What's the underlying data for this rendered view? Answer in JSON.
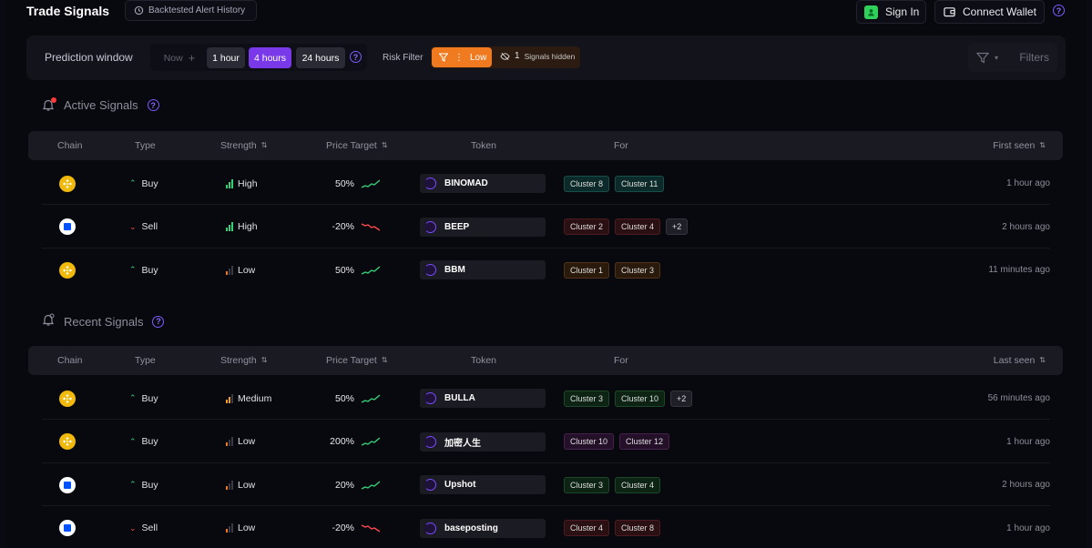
{
  "header": {
    "title": "Trade Signals",
    "history_label": "Backtested Alert History",
    "signin_label": "Sign In",
    "wallet_label": "Connect Wallet"
  },
  "filters": {
    "prediction_label": "Prediction window",
    "windows": [
      "Now",
      "1 hour",
      "4 hours",
      "24 hours"
    ],
    "selected_window": "4 hours",
    "risk_label": "Risk Filter",
    "risk_value": "Low",
    "hidden_count": "1",
    "hidden_label": "Signals hidden",
    "filters_label": "Filters"
  },
  "active": {
    "title": "Active Signals",
    "columns": [
      "Chain",
      "Type",
      "Strength",
      "Price Target",
      "Token",
      "For",
      "First seen"
    ],
    "rows": [
      {
        "chain": "bnb",
        "type": "Buy",
        "strength": "High",
        "target": "50%",
        "token": "BINOMAD",
        "for": [
          [
            "Cluster 8",
            "teal"
          ],
          [
            "Cluster 11",
            "teal"
          ]
        ],
        "seen": "1 hour ago"
      },
      {
        "chain": "base",
        "type": "Sell",
        "strength": "High",
        "target": "-20%",
        "token": "BEEP",
        "for": [
          [
            "Cluster 2",
            "red"
          ],
          [
            "Cluster 4",
            "red"
          ],
          [
            "+2",
            "more"
          ]
        ],
        "seen": "2 hours ago"
      },
      {
        "chain": "bnb",
        "type": "Buy",
        "strength": "Low",
        "target": "50%",
        "token": "BBM",
        "for": [
          [
            "Cluster 1",
            "orange"
          ],
          [
            "Cluster 3",
            "orange"
          ]
        ],
        "seen": "11 minutes ago"
      }
    ]
  },
  "recent": {
    "title": "Recent Signals",
    "columns": [
      "Chain",
      "Type",
      "Strength",
      "Price Target",
      "Token",
      "For",
      "Last seen"
    ],
    "rows": [
      {
        "chain": "bnb",
        "type": "Buy",
        "strength": "Medium",
        "target": "50%",
        "token": "BULLA",
        "for": [
          [
            "Cluster 3",
            "green"
          ],
          [
            "Cluster 10",
            "green"
          ],
          [
            "+2",
            "more"
          ]
        ],
        "seen": "56 minutes ago"
      },
      {
        "chain": "bnb",
        "type": "Buy",
        "strength": "Low",
        "target": "200%",
        "token": "加密人生",
        "for": [
          [
            "Cluster 10",
            "purple"
          ],
          [
            "Cluster 12",
            "purple"
          ]
        ],
        "seen": "1 hour ago"
      },
      {
        "chain": "base",
        "type": "Buy",
        "strength": "Low",
        "target": "20%",
        "token": "Upshot",
        "for": [
          [
            "Cluster 3",
            "green"
          ],
          [
            "Cluster 4",
            "green"
          ]
        ],
        "seen": "2 hours ago"
      },
      {
        "chain": "base",
        "type": "Sell",
        "strength": "Low",
        "target": "-20%",
        "token": "baseposting",
        "for": [
          [
            "Cluster 4",
            "red"
          ],
          [
            "Cluster 8",
            "red"
          ]
        ],
        "seen": "1 hour ago"
      }
    ]
  },
  "colors": {
    "accent": "#7a39e8",
    "risk": "#f07a1f",
    "buy": "#33d17a",
    "sell": "#ff4b4b"
  }
}
